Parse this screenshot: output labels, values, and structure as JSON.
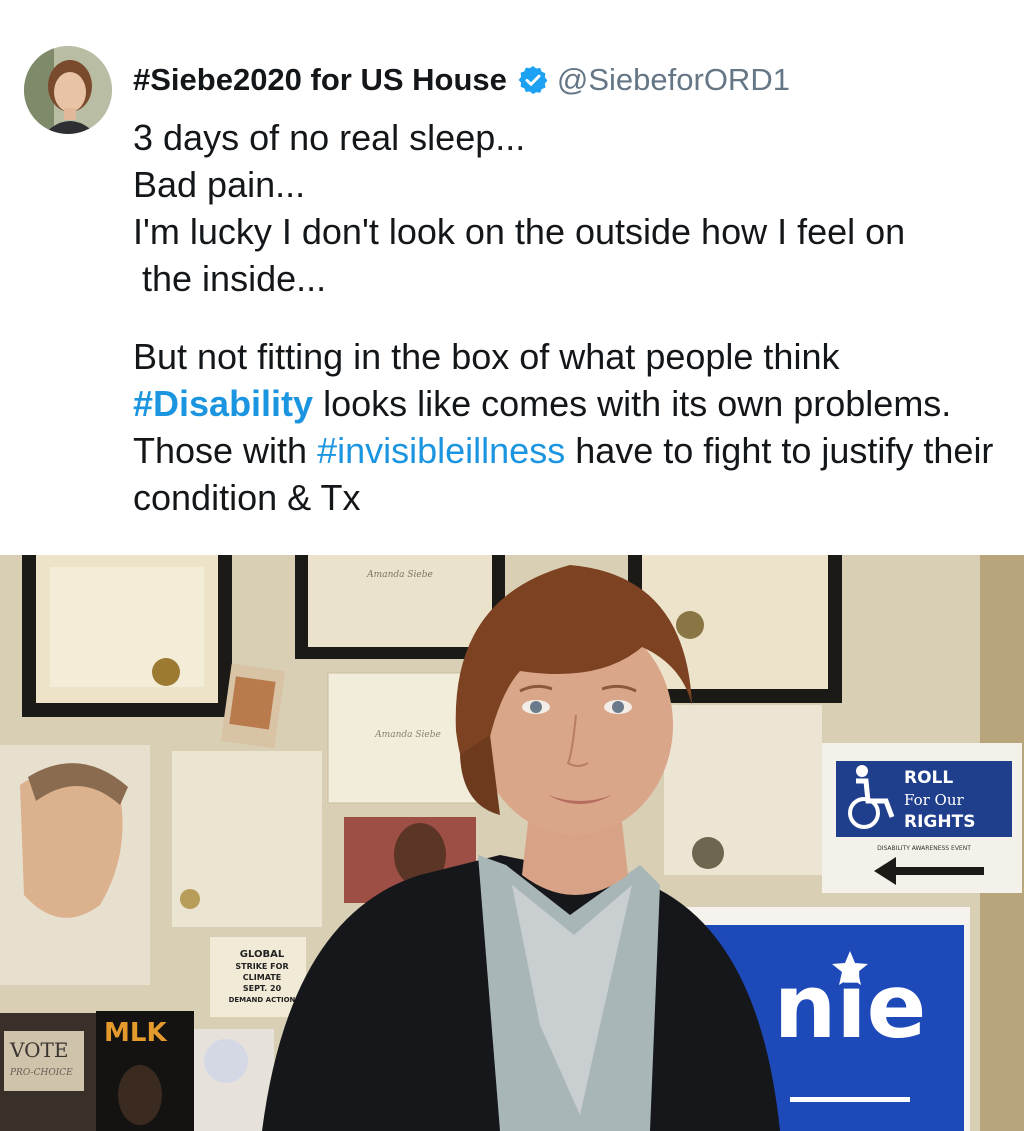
{
  "tweet": {
    "display_name": "#Siebe2020 for US House",
    "handle": "@SiebeforORD1",
    "verified": true,
    "lines": {
      "l1": "3 days of no real sleep...",
      "l2": "Bad pain...",
      "l3": "I'm lucky I don't look on the outside how I feel on",
      "l4": "the inside..."
    },
    "para2": {
      "t1": "But not fitting in the box of what people think",
      "hashtag1": "#Disability",
      "t2": " looks like comes with its own problems. Those with ",
      "hashtag2": "#invisibleillness",
      "t3": " have to fight to justify their condition & Tx"
    }
  },
  "photo": {
    "sign_roll": [
      "ROLL",
      "For Our",
      "RIGHTS"
    ],
    "sign_roll_sub": "DISABILITY AWARENESS EVENT",
    "poster_strike": [
      "GLOBAL",
      "STRIKE FOR",
      "CLIMATE",
      "SEPT. 20",
      "DEMAND ACTION"
    ],
    "poster_vote": "VOTE",
    "poster_vote_sub": "PRO-CHOICE",
    "poster_mlk": "MLK",
    "banner_text": "nie",
    "certificate_name": "Amanda Siebe"
  },
  "colors": {
    "accent": "#1b95e0",
    "text": "#14171a",
    "muted": "#657786",
    "verified_badge": "#1da1f2"
  },
  "icons": {
    "verified": "verified-badge-icon",
    "wheelchair": "wheelchair-icon",
    "arrow": "arrow-left-icon"
  }
}
